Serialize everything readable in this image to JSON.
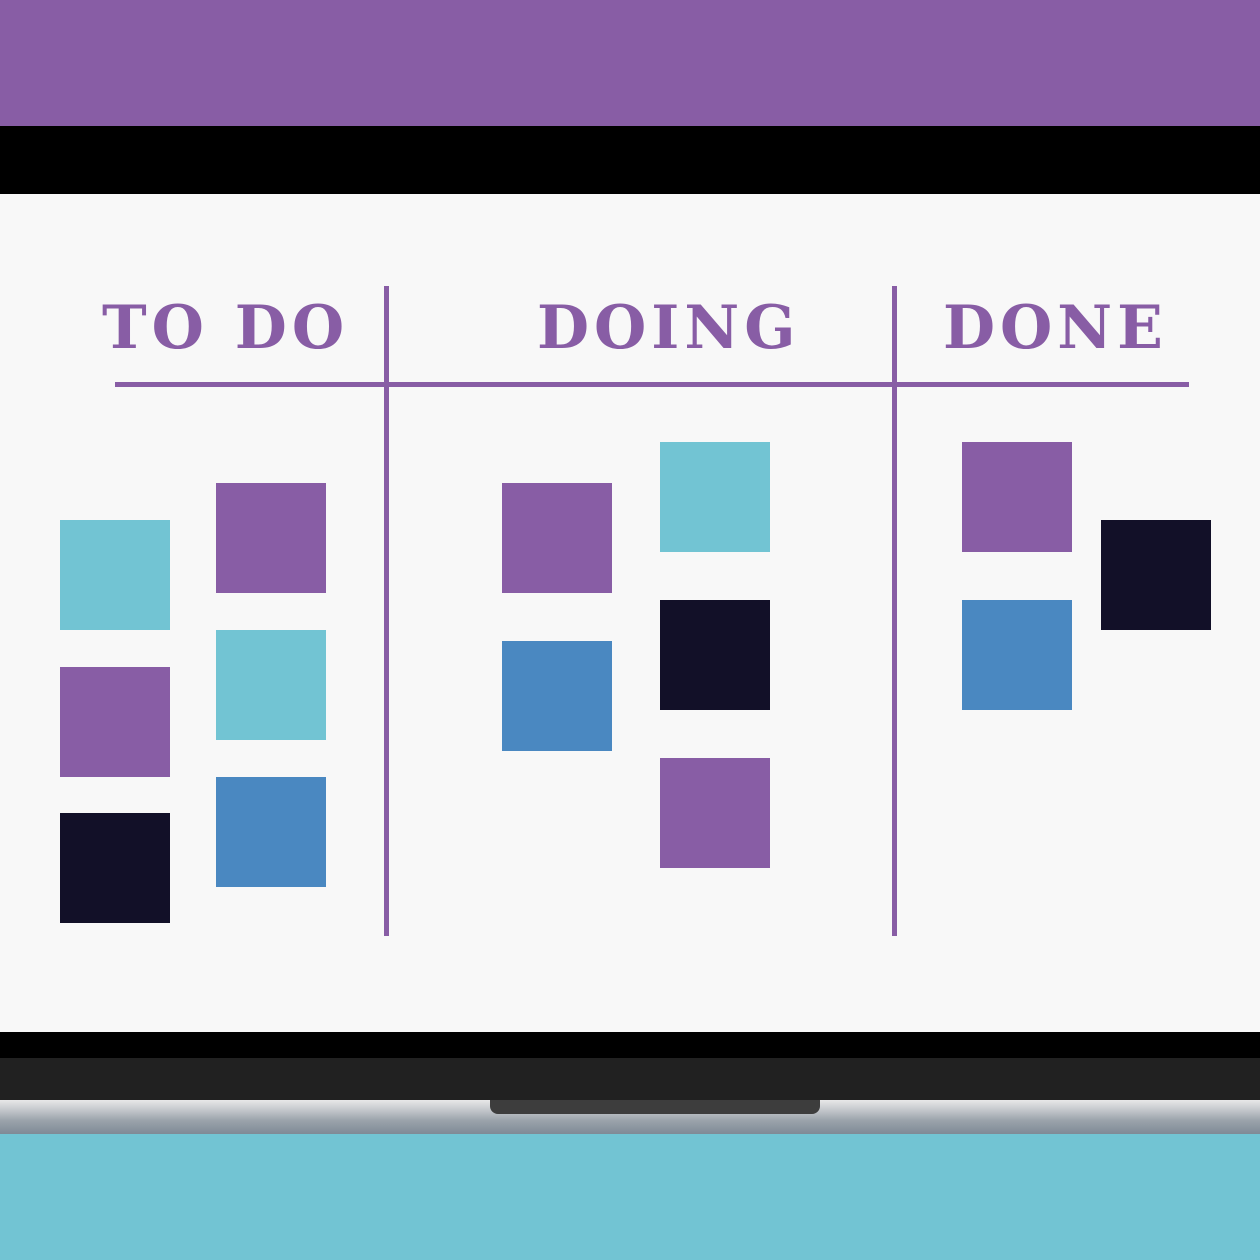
{
  "colors": {
    "purple": "#885da5",
    "teal": "#72c4d3",
    "blue": "#4a88c1",
    "navy": "#121028",
    "screen": "#f8f8f8",
    "bezel": "#000000"
  },
  "board": {
    "columns": [
      {
        "title": "TO DO",
        "cards": [
          "teal",
          "purple",
          "purple",
          "teal",
          "navy",
          "blue"
        ]
      },
      {
        "title": "DOING",
        "cards": [
          "purple",
          "teal",
          "blue",
          "navy",
          "purple"
        ]
      },
      {
        "title": "DONE",
        "cards": [
          "purple",
          "navy",
          "blue"
        ]
      }
    ]
  }
}
